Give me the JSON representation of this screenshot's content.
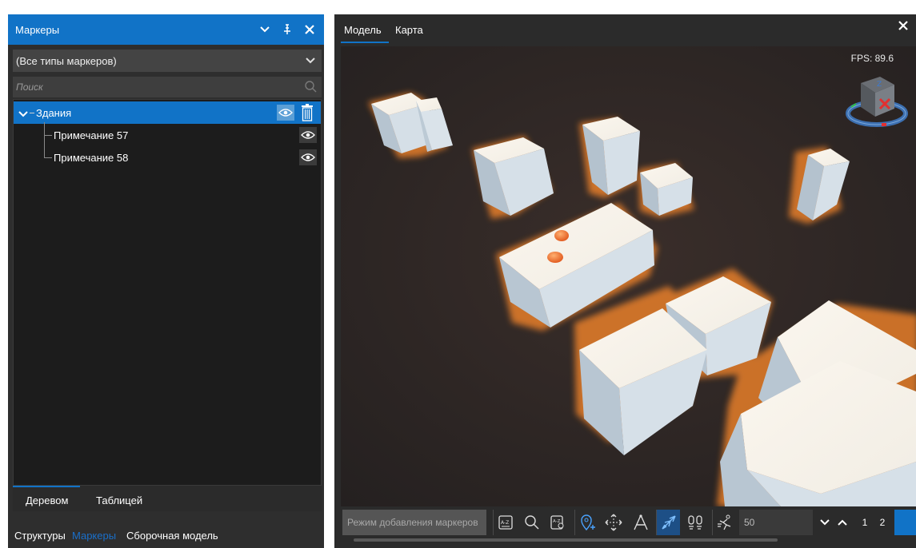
{
  "left_panel": {
    "title": "Маркеры",
    "header_buttons": [
      "chevron-down-icon",
      "pin-icon",
      "close-icon"
    ],
    "type_filter": {
      "selected": "(Все типы маркеров)"
    },
    "search": {
      "placeholder": "Поиск",
      "value": ""
    },
    "tree": [
      {
        "label": "Здания",
        "expanded": true,
        "selected": true,
        "children": [
          {
            "label": "Примечание 57"
          },
          {
            "label": "Примечание 58"
          }
        ]
      }
    ],
    "view_tabs": [
      {
        "label": "Деревом",
        "active": true
      },
      {
        "label": "Таблицей",
        "active": false
      }
    ],
    "panel_tabs": [
      {
        "label": "Структуры",
        "active": false
      },
      {
        "label": "Маркеры",
        "active": true
      },
      {
        "label": "Сборочная модель",
        "active": false
      }
    ]
  },
  "right_panel": {
    "tabs": [
      {
        "label": "Модель",
        "active": true
      },
      {
        "label": "Карта",
        "active": false
      }
    ],
    "fps": "FPS: 89.6",
    "toolbar": {
      "mode_label": "Режим добавления маркеров",
      "scale_value": "50",
      "pages": [
        "1",
        "2"
      ],
      "tools": [
        "sort-az-icon",
        "search-icon",
        "find-az-icon",
        "add-marker-icon",
        "move-icon",
        "measure-icon",
        "fly-icon",
        "walk-icon",
        "run-icon"
      ]
    }
  },
  "colors": {
    "accent": "#1173c7",
    "panel_bg": "#2e2e2e",
    "tree_bg": "#1c1c1c",
    "scene_bg": "#2a2220",
    "building": "#d8e2ea",
    "glow": "#ff8a2a",
    "marker": "#f07028"
  }
}
